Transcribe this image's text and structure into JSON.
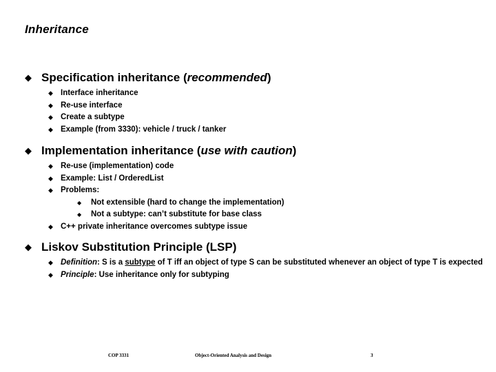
{
  "slide": {
    "title": "Inheritance",
    "bullet_glyph": "◆",
    "sections": [
      {
        "heading_plain": "Specification inheritance (recommended)",
        "heading_pre": "Specification inheritance (",
        "heading_em": "recommended",
        "heading_post": ")",
        "items": [
          {
            "text": "Interface inheritance"
          },
          {
            "text": "Re-use interface"
          },
          {
            "text": "Create a subtype"
          },
          {
            "text": "Example (from 3330): vehicle / truck / tanker"
          }
        ]
      },
      {
        "heading_plain": "Implementation inheritance (use with caution)",
        "heading_pre": "Implementation inheritance (",
        "heading_em": "use with caution",
        "heading_post": ")",
        "items": [
          {
            "text": "Re-use (implementation) code"
          },
          {
            "text": "Example: List / OrderedList"
          },
          {
            "text": "Problems:"
          }
        ],
        "subitems": [
          {
            "text": "Not extensible (hard to change the implementation)"
          },
          {
            "text": "Not a subtype: can’t substitute for base class"
          }
        ],
        "trailing_items": [
          {
            "text": "C++ private inheritance overcomes subtype issue"
          }
        ]
      },
      {
        "heading_plain": "Liskov Substitution Principle (LSP)",
        "heading_pre": "Liskov Substitution Principle (LSP)",
        "heading_em": "",
        "heading_post": "",
        "definition": {
          "label": "Definition",
          "part1": ": S is a ",
          "underlined": "subtype",
          "part2": " of T iff an object of type S can be substituted whenever an object of type T is expected"
        },
        "principle": {
          "label": "Principle",
          "text": ": Use inheritance only for subtyping"
        }
      }
    ]
  },
  "footer": {
    "course_code": "COP 3331",
    "course_name": "Object-Oriented Analysis and Design",
    "page_number": "3"
  }
}
